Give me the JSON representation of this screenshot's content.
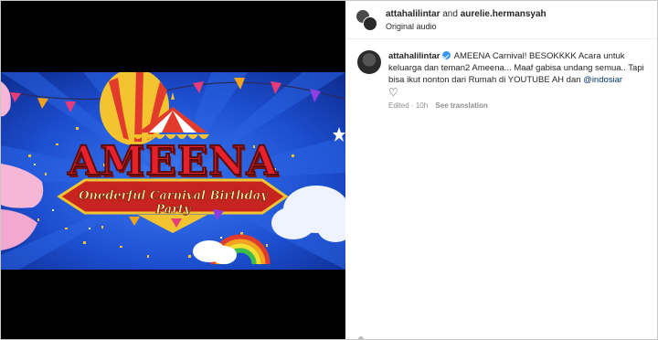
{
  "banner": {
    "title": "AMEENA",
    "subtitle": "Onederful Carnival Birthday Party"
  },
  "header": {
    "user1": "attahalilintar",
    "and_text": "and",
    "user2": "aurelie.hermansyah",
    "audio": "Original audio"
  },
  "caption": {
    "username": "attahalilintar",
    "text": "AMEENA Carnival! BESOKKKK Acara untuk keluarga dan teman2 Ameena... Maaf gabisa undang semua.. Tapi bisa ikut nonton dari Rumah di YOUTUBE AH dan",
    "mention": "@indosiar",
    "edited": "Edited",
    "time": "10h",
    "see_translation": "See translation"
  },
  "icons": {
    "verified": "verified-badge-icon",
    "heart": "heart-icon",
    "sound": "speaker-icon",
    "profile": "user-tag-icon"
  },
  "colors": {
    "verified": "#3897f0",
    "mention": "#00376b",
    "banner_blue": "#1d4fd1",
    "title_red": "#e8202a"
  }
}
